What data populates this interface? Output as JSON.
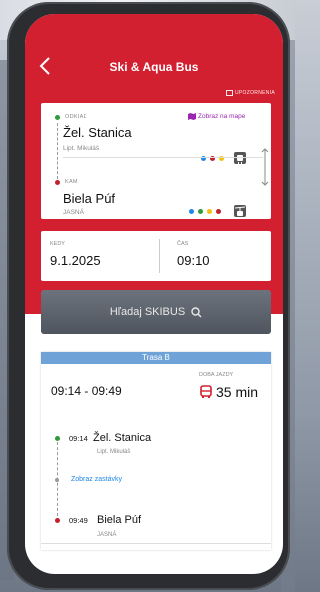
{
  "header": {
    "title": "Ski & Aqua Bus",
    "notify_label": "UPOZORNENIA",
    "bg_color": "#d32030"
  },
  "route": {
    "from": {
      "label": "ODKIAĽ",
      "name": "Žel. Stanica",
      "sub": "Lipt. Mikuláš",
      "dot_color": "#2e9b3b"
    },
    "map_link": "Zobraz na mape",
    "to": {
      "label": "KAM",
      "name": "Biela Púf",
      "sub": "JASNÁ",
      "dot_color": "#c3202e"
    },
    "from_line_colors": [
      "#1e88e5",
      "#c3202e",
      "#f4c20d"
    ],
    "to_line_colors": [
      "#1e88e5",
      "#2e9b3b",
      "#f4c20d",
      "#c3202e"
    ],
    "from_type_icon": "train-icon",
    "to_type_icon": "cable-car-icon"
  },
  "datetime": {
    "date_label": "KEDY",
    "date_value": "9.1.2025",
    "time_label": "ČAS",
    "time_value": "09:10"
  },
  "search": {
    "label": "Hľadaj SKIBUS",
    "icon": "search-icon"
  },
  "results": {
    "header": "Trasa B",
    "header_color": "#6fa3d8",
    "time_range": "09:14 - 09:49",
    "duration_label": "DOBA JAZDY",
    "duration": "35 min",
    "duration_icon": "bus-icon",
    "start": {
      "time": "09:14",
      "name": "Žel. Stanica",
      "sub": "Lipt. Mikuláš"
    },
    "show_stops": "Zobraz zastávky",
    "end": {
      "time": "09:49",
      "name": "Biela Púf",
      "sub": "JASNÁ"
    }
  }
}
